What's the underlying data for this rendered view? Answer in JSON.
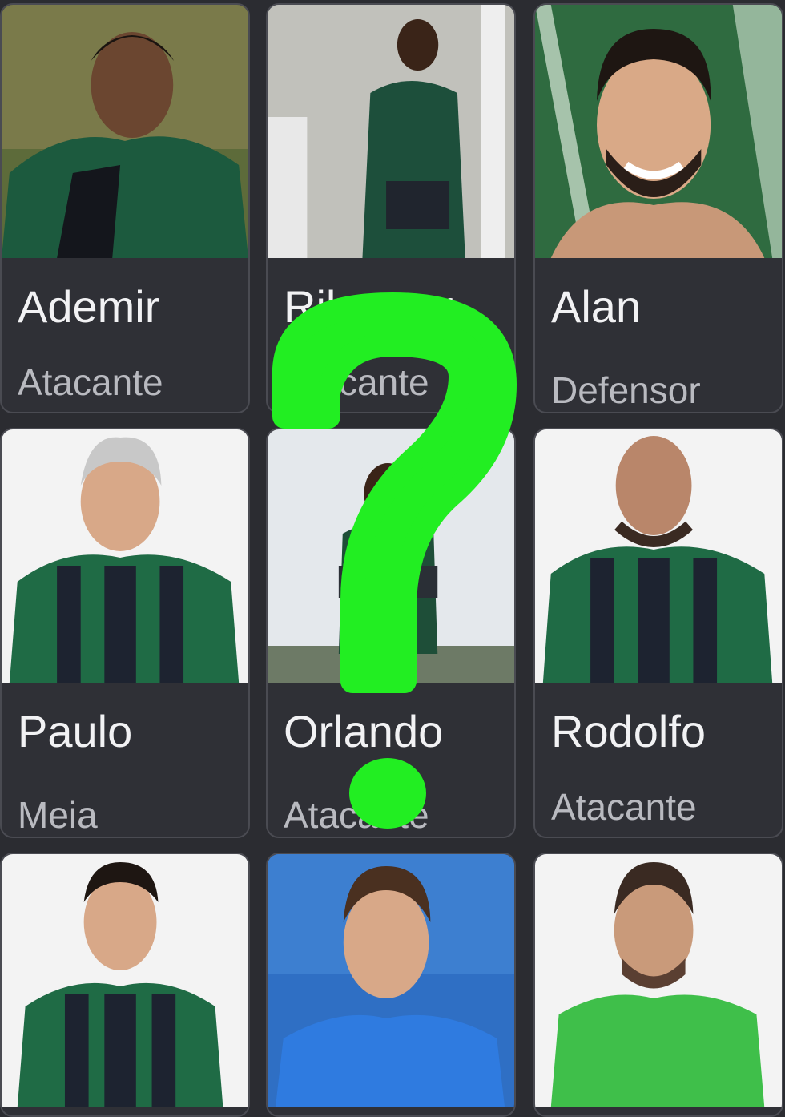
{
  "players": [
    {
      "name": "Ademir",
      "position": "Atacante",
      "photo": "green-jersey-field"
    },
    {
      "name": "Ribamar",
      "position": "Atacante",
      "photo": "goal-net-green-jersey"
    },
    {
      "name": "Alan",
      "position": "Defensor",
      "photo": "selfie-smile"
    },
    {
      "name": "Paulo",
      "position": "Meia",
      "photo": "striped-jersey-studio"
    },
    {
      "name": "Orlando",
      "position": "Atacante",
      "photo": "arms-crossed-outdoor"
    },
    {
      "name": "Rodolfo",
      "position": "Atacante",
      "photo": "striped-jersey-studio"
    },
    {
      "name": "",
      "position": "",
      "photo": "striped-jersey-studio"
    },
    {
      "name": "",
      "position": "",
      "photo": "blue-jersey-stadium"
    },
    {
      "name": "",
      "position": "",
      "photo": "green-goalkeeper-jersey"
    }
  ],
  "overlay": {
    "symbol": "question-mark-icon",
    "color": "#22ee22"
  },
  "colors": {
    "background": "#2b2c31",
    "card": "#2f3036",
    "jersey_green": "#1f6b45",
    "jersey_dark": "#1d2330"
  }
}
